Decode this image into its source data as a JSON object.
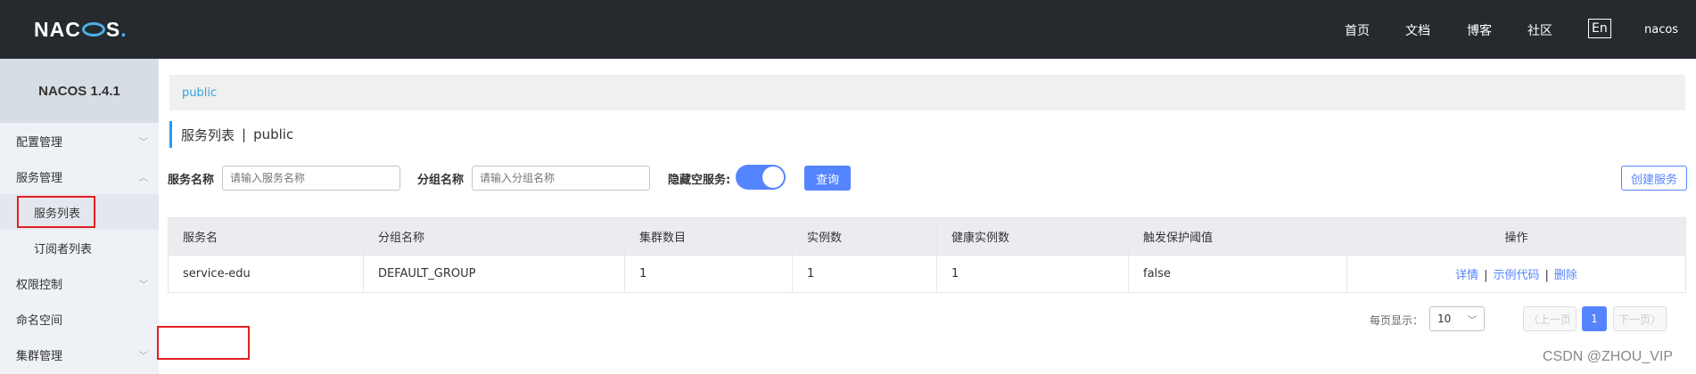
{
  "header": {
    "logo": "NACOS.",
    "nav": [
      "首页",
      "文档",
      "博客",
      "社区"
    ],
    "lang": "En",
    "user": "nacos"
  },
  "sidebar": {
    "version": "NACOS 1.4.1",
    "items": [
      {
        "label": "配置管理"
      },
      {
        "label": "服务管理"
      },
      {
        "label": "服务列表"
      },
      {
        "label": "订阅者列表"
      },
      {
        "label": "权限控制"
      },
      {
        "label": "命名空间"
      },
      {
        "label": "集群管理"
      }
    ]
  },
  "breadcrumb": "public",
  "page": {
    "title": "服务列表",
    "namespace": "public"
  },
  "filters": {
    "service_label": "服务名称",
    "service_placeholder": "请输入服务名称",
    "group_label": "分组名称",
    "group_placeholder": "请输入分组名称",
    "hide_empty_label": "隐藏空服务:",
    "hide_empty_on": true,
    "search_button": "查询",
    "create_button": "创建服务"
  },
  "table": {
    "columns": [
      "服务名",
      "分组名称",
      "集群数目",
      "实例数",
      "健康实例数",
      "触发保护阈值",
      "操作"
    ],
    "rows": [
      {
        "service": "service-edu",
        "group": "DEFAULT_GROUP",
        "clusters": "1",
        "instances": "1",
        "healthy": "1",
        "threshold": "false",
        "actions": [
          "详情",
          "示例代码",
          "删除"
        ]
      }
    ]
  },
  "pagination": {
    "per_page_label": "每页显示：",
    "per_page": "10",
    "prev": "上一页",
    "current": "1",
    "next": "下一页"
  },
  "watermark": "CSDN @ZHOU_VIP"
}
